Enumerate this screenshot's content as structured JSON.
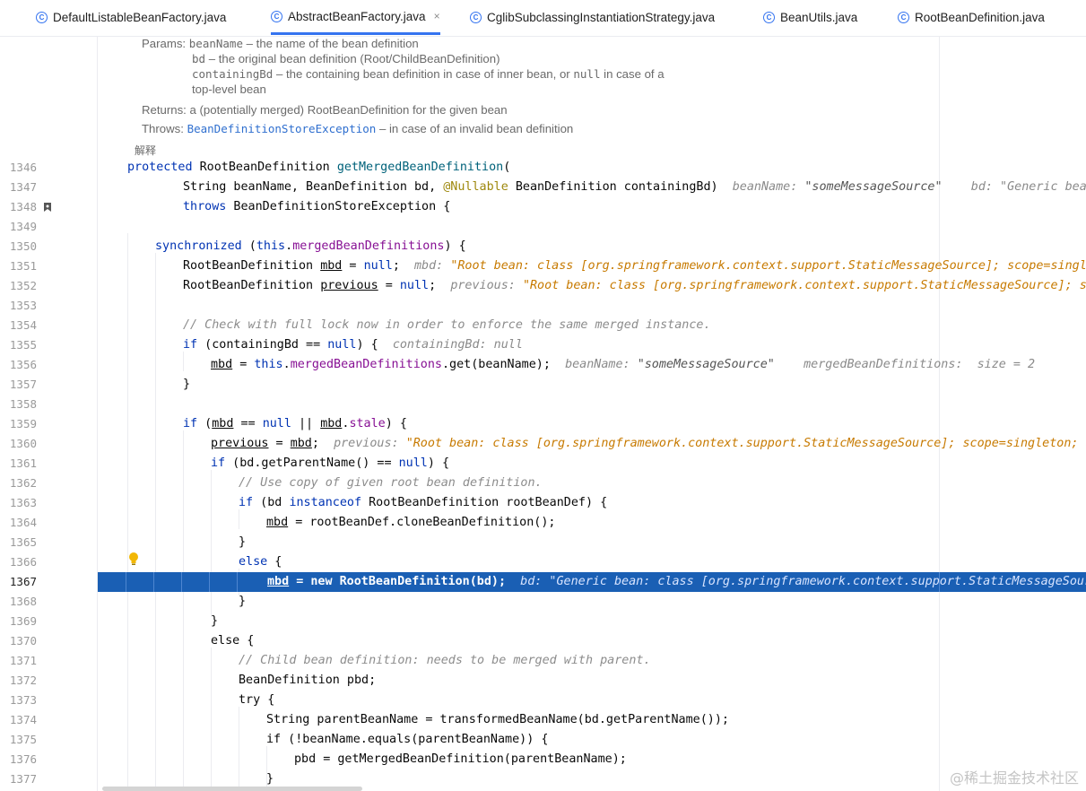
{
  "tabs": [
    {
      "label": "DefaultListableBeanFactory.java",
      "active": false
    },
    {
      "label": "AbstractBeanFactory.java",
      "active": true,
      "close": "×"
    },
    {
      "label": "CglibSubclassingInstantiationStrategy.java",
      "active": false
    },
    {
      "label": "BeanUtils.java",
      "active": false
    },
    {
      "label": "RootBeanDefinition.java",
      "active": false
    }
  ],
  "tab_icon_glyph": "C",
  "doc": {
    "params_label": "Params:",
    "p1_name": "beanName",
    "p1_desc": " – the name of the bean definition",
    "p2_name": "bd",
    "p2_desc": " – the original bean definition (Root/ChildBeanDefinition)",
    "p3_name": "containingBd",
    "p3_desc_a": " – the containing bean definition in case of inner bean, or ",
    "p3_null": "null",
    "p3_desc_b": " in case of a",
    "p3_desc_c": "top-level bean",
    "returns_label": "Returns:",
    "returns_desc": "a (potentially merged) RootBeanDefinition for the given bean",
    "throws_label": "Throws:",
    "throws_link": "BeanDefinitionStoreException",
    "throws_desc": " – in case of an invalid bean definition",
    "render_toggle": "解释"
  },
  "lines": {
    "n1346": "1346",
    "n1347": "1347",
    "n1348": "1348",
    "n1349": "1349",
    "n1350": "1350",
    "n1351": "1351",
    "n1352": "1352",
    "n1353": "1353",
    "n1354": "1354",
    "n1355": "1355",
    "n1356": "1356",
    "n1357": "1357",
    "n1358": "1358",
    "n1359": "1359",
    "n1360": "1360",
    "n1361": "1361",
    "n1362": "1362",
    "n1363": "1363",
    "n1364": "1364",
    "n1365": "1365",
    "n1366": "1366",
    "n1367": "1367",
    "n1368": "1368",
    "n1369": "1369",
    "n1370": "1370",
    "n1371": "1371",
    "n1372": "1372",
    "n1373": "1373",
    "n1374": "1374",
    "n1375": "1375",
    "n1376": "1376",
    "n1377": "1377"
  },
  "code": {
    "l1346_kw": "protected",
    "l1346_type": " RootBeanDefinition ",
    "l1346_fn": "getMergedBeanDefinition",
    "l1346_tail": "(",
    "l1347_a": "String beanName, BeanDefinition bd, ",
    "l1347_ann": "@Nullable",
    "l1347_b": " BeanDefinition containingBd)",
    "l1347_h1": "beanName: ",
    "l1347_h1v": "\"someMessageSource\"",
    "l1347_h2": "bd: \"Generic bean: c",
    "l1348_kw": "throws",
    "l1348_b": " BeanDefinitionStoreException {",
    "l1350_kw": "synchronized",
    "l1350_a": " (",
    "l1350_this": "this",
    "l1350_dot": ".",
    "l1350_fld": "mergedBeanDefinitions",
    "l1350_b": ") {",
    "l1351_a": "RootBeanDefinition ",
    "l1351_var": "mbd",
    "l1351_b": " = ",
    "l1351_null": "null",
    "l1351_c": ";",
    "l1351_h": "mbd: ",
    "l1351_hv": "\"Root bean: class [org.springframework.context.support.StaticMessageSource]; scope=singleton",
    "l1352_a": "RootBeanDefinition ",
    "l1352_var": "previous",
    "l1352_b": " = ",
    "l1352_null": "null",
    "l1352_c": ";",
    "l1352_h": "previous: ",
    "l1352_hv": "\"Root bean: class [org.springframework.context.support.StaticMessageSource]; scope",
    "l1354": "// Check with full lock now in order to enforce the same merged instance.",
    "l1355_kw": "if",
    "l1355_a": " (containingBd == ",
    "l1355_null": "null",
    "l1355_b": ") {",
    "l1355_h": "containingBd: null",
    "l1356_var": "mbd",
    "l1356_a": " = ",
    "l1356_this": "this",
    "l1356_dot": ".",
    "l1356_fld": "mergedBeanDefinitions",
    "l1356_b": ".get(beanName);",
    "l1356_h1": "beanName: ",
    "l1356_h1v": "\"someMessageSource\"",
    "l1356_h2": "mergedBeanDefinitions:  size = 2",
    "l1357": "}",
    "l1359_kw": "if",
    "l1359_a": " (",
    "l1359_var": "mbd",
    "l1359_b": " == ",
    "l1359_null": "null",
    "l1359_c": " || ",
    "l1359_var2": "mbd",
    "l1359_dot": ".",
    "l1359_fld": "stale",
    "l1359_d": ") {",
    "l1360_var": "previous",
    "l1360_a": " = ",
    "l1360_var2": "mbd",
    "l1360_b": ";",
    "l1360_h": "previous: ",
    "l1360_hv": "\"Root bean: class [org.springframework.context.support.StaticMessageSource]; scope=singleton; abst",
    "l1361_kw": "if",
    "l1361_a": " (bd.getParentName() == ",
    "l1361_null": "null",
    "l1361_b": ") {",
    "l1362": "// Use copy of given root bean definition.",
    "l1363_kw": "if",
    "l1363_a": " (bd ",
    "l1363_kw2": "instanceof",
    "l1363_b": " RootBeanDefinition rootBeanDef) {",
    "l1364_var": "mbd",
    "l1364_a": " = rootBeanDef.cloneBeanDefinition();",
    "l1365": "}",
    "l1366_kw": "else",
    "l1366_a": " {",
    "l1367_var": "mbd",
    "l1367_a": " = new RootBeanDefinition(bd);",
    "l1367_h": "bd: \"Generic bean: class [org.springframework.context.support.StaticMessageSource]",
    "l1368": "}",
    "l1369": "}",
    "l1370_kw": "else",
    "l1370_a": " {",
    "l1371": "// Child bean definition: needs to be merged with parent.",
    "l1372": "BeanDefinition pbd;",
    "l1373_kw": "try",
    "l1373_a": " {",
    "l1374": "String parentBeanName = transformedBeanName(bd.getParentName());",
    "l1375_kw": "if",
    "l1375_a": " (!beanName.equals(parentBeanName)) {",
    "l1376": "pbd = getMergedBeanDefinition(parentBeanName);",
    "l1377": "}"
  },
  "watermark": "@稀土掘金技术社区",
  "colors": {
    "keyword": "#0033b3",
    "selection": "#1a5fb4",
    "hint_string": "#c77a00",
    "accent": "#3574f0"
  }
}
